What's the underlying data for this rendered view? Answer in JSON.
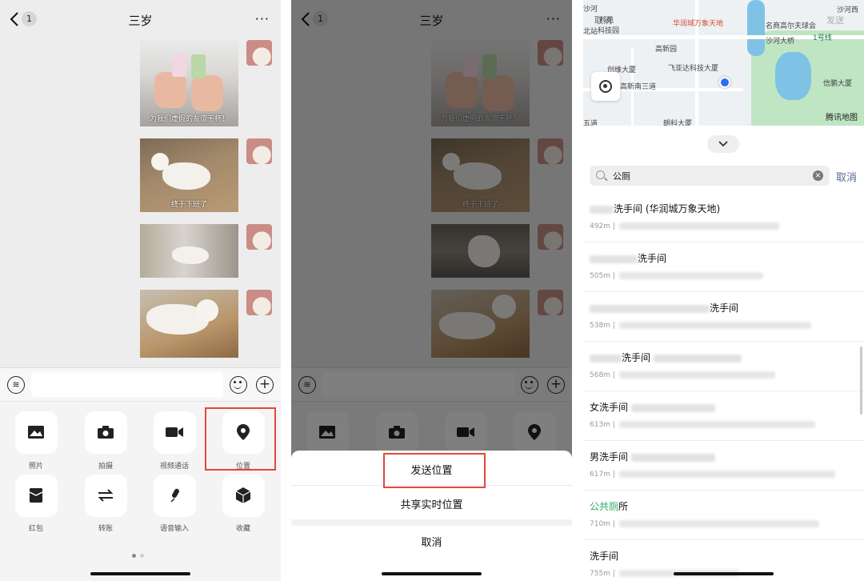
{
  "chat": {
    "back_badge": "1",
    "title": "三岁",
    "more": "···",
    "captions": [
      "为我们虚假的友谊干杯！",
      "终于下班了"
    ]
  },
  "input_bar": {
    "voice": "≋"
  },
  "tools": [
    {
      "label": "照片",
      "icon": "photo-icon"
    },
    {
      "label": "拍摄",
      "icon": "camera-icon"
    },
    {
      "label": "视频通话",
      "icon": "video-icon"
    },
    {
      "label": "位置",
      "icon": "location-pin-icon"
    },
    {
      "label": "红包",
      "icon": "red-envelope-icon"
    },
    {
      "label": "转账",
      "icon": "transfer-icon"
    },
    {
      "label": "语音输入",
      "icon": "microphone-icon"
    },
    {
      "label": "收藏",
      "icon": "favorites-box-icon"
    }
  ],
  "sheet": {
    "send_location": "发送位置",
    "share_realtime": "共享实时位置",
    "cancel": "取消"
  },
  "map": {
    "top_cancel": "取消",
    "top_send": "发送",
    "labels": [
      "科技园",
      "华润城万象天地",
      "名商高尔夫球会",
      "沙河",
      "高新园",
      "沙河大桥",
      "创维大厦",
      "飞亚达科技大厦",
      "高新南三道",
      "信鹏大厦",
      "朗科大厦",
      "五道",
      "科苑",
      "北站",
      "沙河西",
      "1号线"
    ],
    "attribution": "腾讯地图"
  },
  "search": {
    "query": "公厕",
    "clear": "×",
    "cancel": "取消"
  },
  "results": [
    {
      "name": "洗手间 (华润城万象天地)",
      "distance": "492m |"
    },
    {
      "name": "洗手间",
      "distance": "505m |"
    },
    {
      "name": "洗手间",
      "distance": "538m |"
    },
    {
      "name": "洗手间",
      "distance": "568m |"
    },
    {
      "name": "女洗手间",
      "distance": "613m |"
    },
    {
      "name": "男洗手间",
      "distance": "617m |"
    },
    {
      "name_pre": "公共",
      "name_hl": "厕",
      "name_post": "所",
      "distance": "710m |"
    },
    {
      "name": "洗手间",
      "distance": "755m |"
    }
  ],
  "colors": {
    "highlight_box": "#e4473b",
    "link": "#576b95",
    "match": "#2aae67",
    "user_dot": "#2e6cf6"
  }
}
